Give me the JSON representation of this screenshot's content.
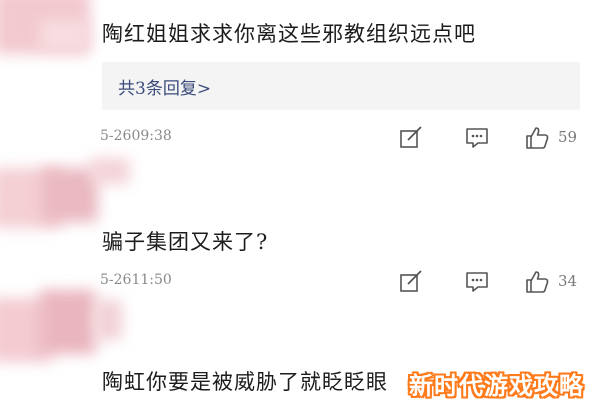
{
  "comments": [
    {
      "text": "陶红姐姐求求你离这些邪教组织远点吧",
      "reply_summary": "共3条回复>",
      "timestamp": "5-2609:38",
      "like_count": "59"
    },
    {
      "text": "骗子集团又来了?",
      "timestamp": "5-2611:50",
      "like_count": "34"
    },
    {
      "text": "陶虹你要是被威胁了就眨眨眼"
    }
  ],
  "icons": {
    "edit": "edit-icon",
    "comment": "comment-icon",
    "like": "thumbs-up-icon"
  },
  "watermark": {
    "text": "新时代游戏攻略",
    "color": "#ff7a1a"
  },
  "colors": {
    "reply_link": "#3b4b7a",
    "meta_gray": "#8a8a8a",
    "avatar_blur": "#eab9c1"
  }
}
